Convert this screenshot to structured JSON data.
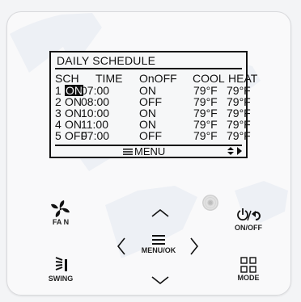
{
  "lcd": {
    "title": "DAILY SCHEDULE",
    "headers": {
      "sch": "SCH",
      "time": "TIME",
      "onoff": "OnOFF",
      "cool": "COOL",
      "heat": "HEAT"
    },
    "rows": [
      {
        "sch": "1",
        "on": "ON",
        "time": "07:00",
        "onoff": "ON",
        "cool": "79°F",
        "heat": "79°F",
        "selected": true
      },
      {
        "sch": "2",
        "on": "ON",
        "time": "08:00",
        "onoff": "OFF",
        "cool": "79°F",
        "heat": "79°F"
      },
      {
        "sch": "3",
        "on": "ON",
        "time": "10:00",
        "onoff": "ON",
        "cool": "79°F",
        "heat": "79°F"
      },
      {
        "sch": "4",
        "on": "ON",
        "time": "11:00",
        "onoff": "ON",
        "cool": "79°F",
        "heat": "79°F"
      },
      {
        "sch": "5",
        "on": "OFF",
        "time": "07:00",
        "onoff": "OFF",
        "cool": "79°F",
        "heat": "79°F"
      }
    ],
    "footer": {
      "menu": "MENU"
    }
  },
  "buttons": {
    "fan": "FA N",
    "swing": "SWING",
    "menu": "MENU/OK",
    "onoff": "ON/OFF",
    "mode": "MODE"
  },
  "icons": {
    "menu": "menu-icon",
    "fan": "fan-icon",
    "swing": "swing-icon",
    "up": "up-arrow-icon",
    "down": "down-arrow-icon",
    "left": "left-arrow-icon",
    "right": "right-arrow-icon",
    "power": "power-icon",
    "mode": "mode-icon",
    "updown": "up-down-icon"
  },
  "colors": {
    "panel": "#f9f9fa",
    "lcd": "#f6f7f8",
    "ink": "#111111",
    "watermark": "#b7c6df"
  }
}
